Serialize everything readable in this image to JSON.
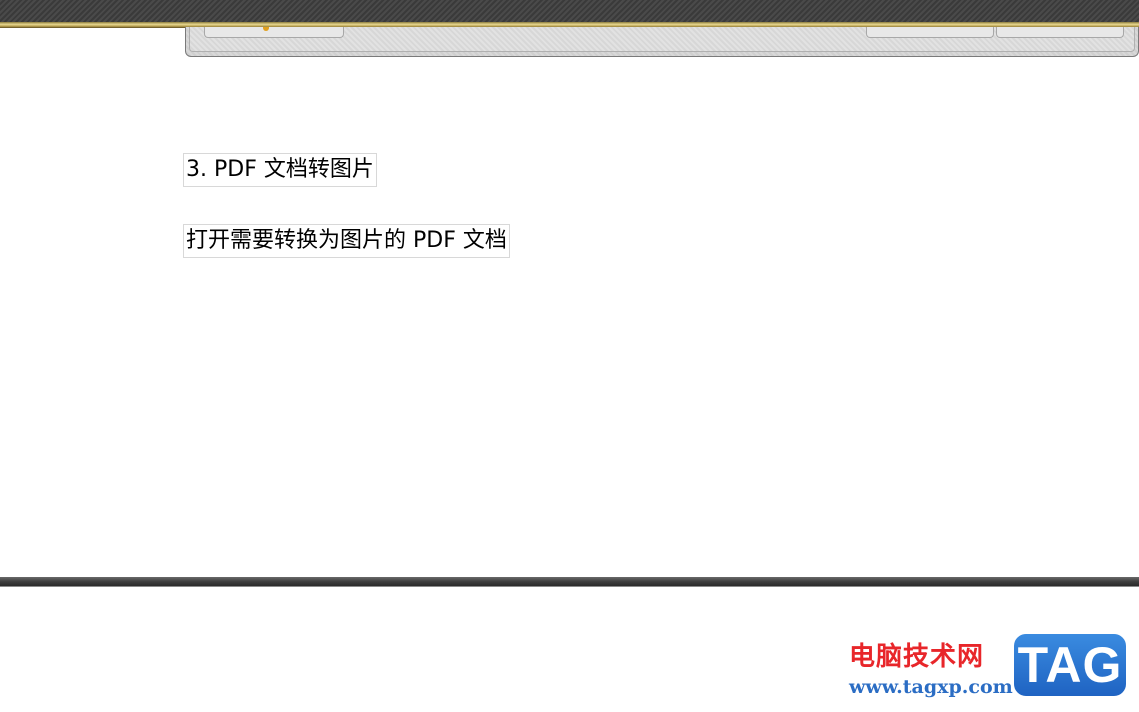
{
  "document": {
    "heading": "3.  PDF 文档转图片",
    "step_text": "打开需要转换为图片的 PDF 文档"
  },
  "watermark": {
    "site_name": "电脑技术网",
    "url": "www.tagxp.com",
    "logo_text": "TAG"
  },
  "colors": {
    "watermark_red": "#e8262a",
    "watermark_blue": "#2b6dc4",
    "logo_blue": "#2a78d8"
  }
}
